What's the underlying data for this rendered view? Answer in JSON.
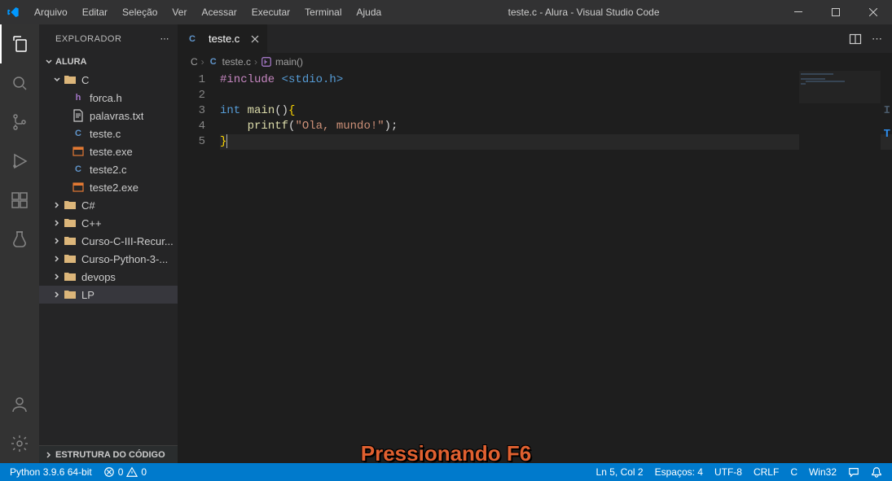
{
  "window": {
    "title": "teste.c - Alura - Visual Studio Code"
  },
  "menu": [
    "Arquivo",
    "Editar",
    "Seleção",
    "Ver",
    "Acessar",
    "Executar",
    "Terminal",
    "Ajuda"
  ],
  "sidebar": {
    "title": "EXPLORADOR",
    "workspace": "ALURA",
    "outline_title": "ESTRUTURA DO CÓDIGO",
    "tree": [
      {
        "type": "folder",
        "name": "C",
        "depth": 1,
        "expanded": true
      },
      {
        "type": "file",
        "name": "forca.h",
        "depth": 2,
        "icon": "h"
      },
      {
        "type": "file",
        "name": "palavras.txt",
        "depth": 2,
        "icon": "txt"
      },
      {
        "type": "file",
        "name": "teste.c",
        "depth": 2,
        "icon": "c"
      },
      {
        "type": "file",
        "name": "teste.exe",
        "depth": 2,
        "icon": "exe"
      },
      {
        "type": "file",
        "name": "teste2.c",
        "depth": 2,
        "icon": "c"
      },
      {
        "type": "file",
        "name": "teste2.exe",
        "depth": 2,
        "icon": "exe"
      },
      {
        "type": "folder",
        "name": "C#",
        "depth": 1,
        "expanded": false
      },
      {
        "type": "folder",
        "name": "C++",
        "depth": 1,
        "expanded": false
      },
      {
        "type": "folder",
        "name": "Curso-C-III-Recur...",
        "depth": 1,
        "expanded": false
      },
      {
        "type": "folder",
        "name": "Curso-Python-3-...",
        "depth": 1,
        "expanded": false
      },
      {
        "type": "folder",
        "name": "devops",
        "depth": 1,
        "expanded": false
      },
      {
        "type": "folder",
        "name": "LP",
        "depth": 1,
        "expanded": false,
        "selected": true
      }
    ]
  },
  "tabs": [
    {
      "label": "teste.c",
      "icon": "c",
      "active": true
    }
  ],
  "breadcrumbs": [
    {
      "label": "C"
    },
    {
      "label": "teste.c",
      "icon": "c"
    },
    {
      "label": "main()",
      "icon": "fn"
    }
  ],
  "code": {
    "lines": [
      {
        "n": 1,
        "tokens": [
          [
            "keyword",
            "#include"
          ],
          [
            "punc",
            " "
          ],
          [
            "include",
            "<stdio.h>"
          ]
        ]
      },
      {
        "n": 2,
        "tokens": []
      },
      {
        "n": 3,
        "tokens": [
          [
            "type",
            "int"
          ],
          [
            "punc",
            " "
          ],
          [
            "fn",
            "main"
          ],
          [
            "punc",
            "()"
          ],
          [
            "brace",
            "{"
          ]
        ]
      },
      {
        "n": 4,
        "tokens": [
          [
            "punc",
            "    "
          ],
          [
            "fn",
            "printf"
          ],
          [
            "punc",
            "("
          ],
          [
            "str",
            "\"Ola, mundo!\""
          ],
          [
            "punc",
            ");"
          ]
        ]
      },
      {
        "n": 5,
        "tokens": [
          [
            "brace",
            "}"
          ]
        ],
        "active": true,
        "cursorAfter": true
      }
    ]
  },
  "status": {
    "python": "Python 3.9.6 64-bit",
    "errors": "0",
    "warnings": "0",
    "lncol": "Ln 5, Col 2",
    "spaces": "Espaços: 4",
    "encoding": "UTF-8",
    "eol": "CRLF",
    "lang": "C",
    "platform": "Win32"
  },
  "overlay": "Pressionando F6"
}
